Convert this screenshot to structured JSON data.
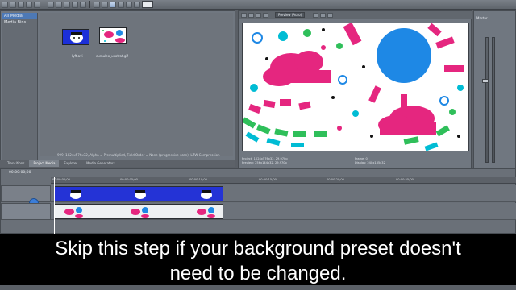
{
  "toolbar": {
    "search_placeholder": ""
  },
  "media": {
    "tree": [
      "All Media",
      "Media Bins"
    ],
    "items": [
      {
        "label": "lyft.avi"
      },
      {
        "label": "cumuleo_ukotrat.gif"
      }
    ],
    "status": "999, 1024x576x32, Alpha = Premultiplied, Field Order = None (progressive scan), LZW Compression"
  },
  "media_tabs": [
    "Transitions",
    "Project Media",
    "Explorer",
    "Media Generators"
  ],
  "preview": {
    "mode": "Preview (Auto)",
    "info_left": [
      "Project: 1024x576x32, 29.970p",
      "Preview: 256x144x32, 29.970p"
    ],
    "info_right": [
      "Frame: 0",
      "Display: 240x135x32"
    ]
  },
  "master": {
    "title": "Master"
  },
  "timeline": {
    "timecode": "00:00:00;00",
    "ruler_labels": [
      "00:00:00;00",
      "00:00:05;00",
      "00:00:10;00",
      "00:00:15;00",
      "00:00:20;00",
      "00:00:25;00"
    ]
  },
  "caption": {
    "line1": "Skip this step if your background preset doesn't",
    "line2": "need to be changed."
  },
  "colors": {
    "accent": "#3b7dd8",
    "sun": "#1e88e5",
    "cloud": "#e5267f"
  }
}
